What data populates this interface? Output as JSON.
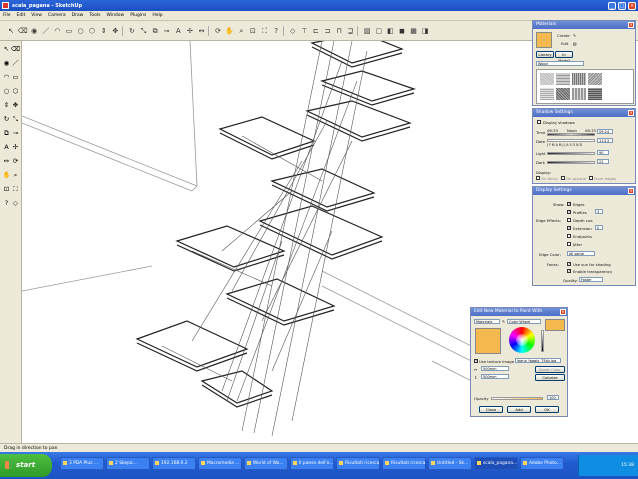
{
  "window": {
    "title": "scala_pagana - SketchUp",
    "minimize": "_",
    "maximize": "□",
    "close": "×"
  },
  "menu": [
    "File",
    "Edit",
    "View",
    "Camera",
    "Draw",
    "Tools",
    "Window",
    "Plugins",
    "Help"
  ],
  "toolbar_icons": [
    "select-icon",
    "eraser-icon",
    "paint-bucket-icon",
    "line-icon",
    "arc-icon",
    "rectangle-icon",
    "circle-icon",
    "polygon-icon",
    "push-pull-icon",
    "move-icon",
    "rotate-icon",
    "scale-icon",
    "offset-icon",
    "tape-icon",
    "text-icon",
    "axes-icon",
    "dimension-icon",
    "orbit-icon",
    "pan-icon",
    "zoom-icon",
    "zoom-window-icon",
    "zoom-extents-icon",
    "help-icon",
    "iso-view-icon",
    "top-view-icon",
    "front-view-icon",
    "right-view-icon",
    "back-view-icon",
    "left-view-icon",
    "xray-icon",
    "wireframe-icon",
    "hidden-line-icon",
    "shaded-icon",
    "textured-icon",
    "monochrome-icon"
  ],
  "materials": {
    "title": "Materials",
    "create": "Create",
    "edit": "Edit",
    "tab_library": "Library",
    "tab_model": "In Model",
    "dropdown": "Wood",
    "colors": {
      "preview": "#f3b84e"
    }
  },
  "shadow": {
    "title": "Shadow Settings",
    "display": "Display shadows",
    "time_label": "Time",
    "time_val": "09:24",
    "time_start": "06:33",
    "time_noon": "Noon",
    "time_end": "06:33",
    "date_label": "Date",
    "date_val": "11/13",
    "months": "J F M A M J J A S O N D",
    "light_label": "Light",
    "light_val": "90",
    "dark_label": "Dark",
    "dark_val": "22",
    "display_label": "Display:",
    "on_faces": "On faces",
    "on_ground": "On ground",
    "from_edges": "From edges"
  },
  "display": {
    "title": "Display Settings",
    "show_label": "Show:",
    "edges": "Edges",
    "profiles": "Profiles",
    "profiles_val": "3",
    "edge_effects": "Edge Effects:",
    "depth_cue": "Depth cue",
    "extension": "Extension",
    "extension_val": "0",
    "endpoints": "Endpoints",
    "jitter": "Jitter",
    "edge_color_label": "Edge Color:",
    "edge_color_val": "All same",
    "faces_label": "Faces:",
    "hidden_line": "Use sun for shading",
    "enable_transparency": "Enable transparency",
    "quality_label": "Quality:",
    "quality_val": "Faster"
  },
  "editmat": {
    "title": "Edit New Material to Paint With",
    "name": "Materiale",
    "picker": "Color Wheel",
    "use_texture": "Use texture image",
    "texture_file": "legno_faggio_75tiz.jpg",
    "width_val": "500mm",
    "height_val": "500mm",
    "reset_color": "Reset Color",
    "colorize": "Colorize",
    "opacity_label": "Opacity",
    "opacity_val": "100",
    "close": "Close",
    "add": "Add",
    "ok": "OK",
    "colors": {
      "preview": "#f3b84e"
    }
  },
  "status": "Drag in direction to pan",
  "taskbar": {
    "start": "start",
    "tasks": [
      "3 PDA Plus ...",
      "2 Skepa...",
      "192.168.0.2",
      "Macromedia ...",
      "World of Wa...",
      "Il paese dell'o...",
      "Risultati ricerca...",
      "Risultati ricerca...",
      "Untitled - Sk...",
      "scala_pagana...",
      "Adobe Photo..."
    ],
    "clock": "15:38"
  }
}
